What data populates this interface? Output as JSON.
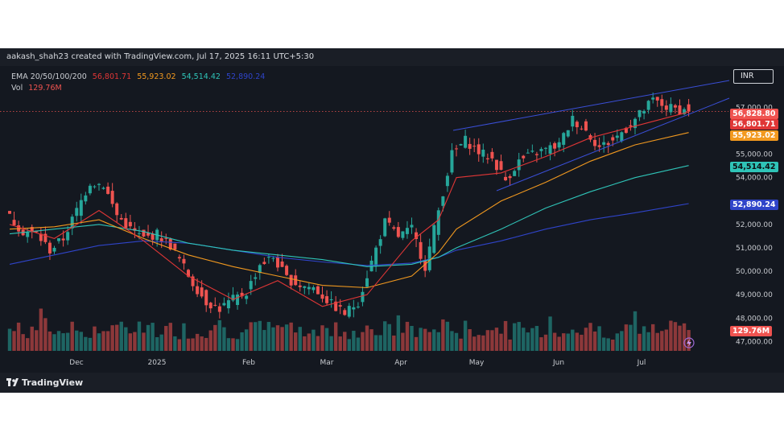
{
  "header": {
    "text": "aakash_shah23 created with TradingView.com, Jul 17, 2025 16:11 UTC+5:30"
  },
  "brand": {
    "text": "TradingView"
  },
  "legend": {
    "ema_label": "EMA 20/50/100/200",
    "ema_values": [
      "56,801.71",
      "55,923.02",
      "54,514.42",
      "52,890.24"
    ],
    "vol_label": "Vol",
    "vol_value": "129.76M"
  },
  "currency": "INR",
  "colors": {
    "up": "#26a69a",
    "down": "#ef5350",
    "ema20": "#e03636",
    "ema50": "#f2991f",
    "ema100": "#2fc4b8",
    "ema200": "#2f44c9",
    "channel": "#3a4fd8",
    "background": "#141820"
  },
  "badges": {
    "price": "56,828.80",
    "ema20": "56,801.71",
    "ema50": "55,923.02",
    "ema100": "54,514.42",
    "ema200": "52,890.24",
    "volume": "129.76M"
  },
  "chart_data": {
    "type": "candlestick",
    "x_labels": [
      "Dec",
      "2025",
      "Feb",
      "Mar",
      "Apr",
      "May",
      "Jun",
      "Jul"
    ],
    "y_ticks": [
      "47,000.00",
      "48,000.00",
      "49,000.00",
      "50,000.00",
      "51,000.00",
      "52,000.00",
      "54,000.00",
      "55,000.00",
      "57,000.00"
    ],
    "ylim": [
      46500,
      58800
    ],
    "last_price": 56828.8,
    "close_path": [
      [
        0,
        52300
      ],
      [
        3,
        51700
      ],
      [
        6,
        51600
      ],
      [
        9,
        50900
      ],
      [
        12,
        51400
      ],
      [
        15,
        52600
      ],
      [
        18,
        53800
      ],
      [
        21,
        53700
      ],
      [
        24,
        52400
      ],
      [
        27,
        51800
      ],
      [
        30,
        51400
      ],
      [
        33,
        51600
      ],
      [
        36,
        51100
      ],
      [
        38,
        50500
      ],
      [
        41,
        49500
      ],
      [
        44,
        48700
      ],
      [
        47,
        48400
      ],
      [
        50,
        48800
      ],
      [
        53,
        49100
      ],
      [
        56,
        50300
      ],
      [
        59,
        50600
      ],
      [
        62,
        49700
      ],
      [
        65,
        49400
      ],
      [
        68,
        49300
      ],
      [
        72,
        48600
      ],
      [
        75,
        48200
      ],
      [
        78,
        48700
      ],
      [
        81,
        50400
      ],
      [
        84,
        52100
      ],
      [
        87,
        51500
      ],
      [
        90,
        51800
      ],
      [
        93,
        50200
      ],
      [
        96,
        52600
      ],
      [
        99,
        55000
      ],
      [
        102,
        55600
      ],
      [
        105,
        55100
      ],
      [
        108,
        54800
      ],
      [
        111,
        53900
      ],
      [
        114,
        54700
      ],
      [
        117,
        55000
      ],
      [
        120,
        55200
      ],
      [
        123,
        55400
      ],
      [
        126,
        56500
      ],
      [
        129,
        56000
      ],
      [
        132,
        55300
      ],
      [
        135,
        55600
      ],
      [
        138,
        56100
      ],
      [
        141,
        56700
      ],
      [
        144,
        57300
      ],
      [
        147,
        57000
      ],
      [
        150,
        56900
      ],
      [
        152,
        56828.8
      ]
    ],
    "ema20_path": [
      [
        0,
        52000
      ],
      [
        10,
        51400
      ],
      [
        20,
        52600
      ],
      [
        30,
        51300
      ],
      [
        40,
        49800
      ],
      [
        50,
        48800
      ],
      [
        60,
        49600
      ],
      [
        70,
        48500
      ],
      [
        80,
        49000
      ],
      [
        90,
        51300
      ],
      [
        96,
        52200
      ],
      [
        100,
        54000
      ],
      [
        110,
        54200
      ],
      [
        120,
        54900
      ],
      [
        130,
        55700
      ],
      [
        140,
        56200
      ],
      [
        152,
        56801.71
      ]
    ],
    "ema50_path": [
      [
        0,
        51800
      ],
      [
        10,
        51900
      ],
      [
        20,
        52200
      ],
      [
        30,
        51400
      ],
      [
        40,
        50700
      ],
      [
        50,
        50200
      ],
      [
        60,
        49800
      ],
      [
        70,
        49400
      ],
      [
        80,
        49300
      ],
      [
        90,
        49800
      ],
      [
        96,
        50800
      ],
      [
        100,
        51800
      ],
      [
        110,
        53000
      ],
      [
        120,
        53800
      ],
      [
        130,
        54700
      ],
      [
        140,
        55400
      ],
      [
        152,
        55923.02
      ]
    ],
    "ema100_path": [
      [
        0,
        51600
      ],
      [
        10,
        51800
      ],
      [
        20,
        52000
      ],
      [
        30,
        51700
      ],
      [
        40,
        51200
      ],
      [
        50,
        50900
      ],
      [
        60,
        50700
      ],
      [
        70,
        50500
      ],
      [
        80,
        50200
      ],
      [
        90,
        50300
      ],
      [
        96,
        50600
      ],
      [
        100,
        51000
      ],
      [
        110,
        51800
      ],
      [
        120,
        52700
      ],
      [
        130,
        53400
      ],
      [
        140,
        54000
      ],
      [
        152,
        54514.42
      ]
    ],
    "ema200_path": [
      [
        0,
        50300
      ],
      [
        10,
        50700
      ],
      [
        20,
        51100
      ],
      [
        30,
        51300
      ],
      [
        40,
        51200
      ],
      [
        50,
        50900
      ],
      [
        60,
        50600
      ],
      [
        70,
        50400
      ],
      [
        80,
        50250
      ],
      [
        90,
        50350
      ],
      [
        96,
        50600
      ],
      [
        100,
        50900
      ],
      [
        110,
        51300
      ],
      [
        120,
        51800
      ],
      [
        130,
        52200
      ],
      [
        140,
        52500
      ],
      [
        152,
        52890.24
      ]
    ],
    "volume_max": 300,
    "volume_last": 129.76,
    "volume_unit": "M"
  }
}
